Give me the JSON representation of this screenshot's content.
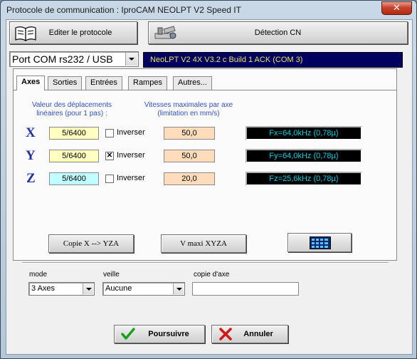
{
  "window": {
    "title": "Protocole de communication : IproCAM NEOLPT V2 Speed IT",
    "close": "✕"
  },
  "toolbar": {
    "edit_protocol": "Editer le protocole",
    "cn_detection": "Détection CN"
  },
  "port": {
    "selected": "Port COM rs232 / USB"
  },
  "status": {
    "text": "NeoLPT V2 4X V3.2 c Build 1 ACK  (COM 3)"
  },
  "tabs": [
    {
      "label": "Axes"
    },
    {
      "label": "Sorties"
    },
    {
      "label": "Entrées"
    },
    {
      "label": "Rampes"
    },
    {
      "label": "Autres..."
    }
  ],
  "axes_panel": {
    "disp_header_1": "Valeur des déplacements",
    "disp_header_2": "linéaires (pour 1 pas) :",
    "speed_header_1": "Vitesses maximales par axe",
    "speed_header_2": "(limitation en mm/s)",
    "invert_label": "Inverser",
    "rows": [
      {
        "axis": "X",
        "step": "5/6400",
        "inverted": false,
        "speed": "50,0",
        "freq": "Fx=64,0kHz  (0,78µ)"
      },
      {
        "axis": "Y",
        "step": "5/6400",
        "inverted": true,
        "speed": "50,0",
        "freq": "Fy=64,0kHz  (0,78µ)"
      },
      {
        "axis": "Z",
        "step": "5/6400",
        "inverted": false,
        "speed": "20,0",
        "freq": "Fz=25,6kHz  (0,78µ)"
      }
    ],
    "copy_x_button": "Copie X --> YZA",
    "vmax_button": "V maxi XYZA",
    "check_mark": "✕"
  },
  "bottom": {
    "mode_label": "mode",
    "mode_value": "3 Axes",
    "sleep_label": "veille",
    "sleep_value": "Aucune",
    "copy_axis_label": "copie d'axe",
    "copy_axis_value": ""
  },
  "actions": {
    "continue": "Poursuivre",
    "cancel": "Annuler"
  },
  "colors": {
    "status_bg": "#000060",
    "status_text": "#f0e060",
    "step_x": "#ffffc0",
    "step_y": "#ffffc0",
    "step_z": "#c0ffff",
    "speed_bg": "#ffdcbc",
    "freq_text": "#00d0e0",
    "label_blue": "#3050c8"
  },
  "icons": [
    "book-icon",
    "cnc-machine-icon",
    "calculator-icon",
    "check-icon",
    "cancel-icon",
    "dropdown-arrow-icon"
  ]
}
